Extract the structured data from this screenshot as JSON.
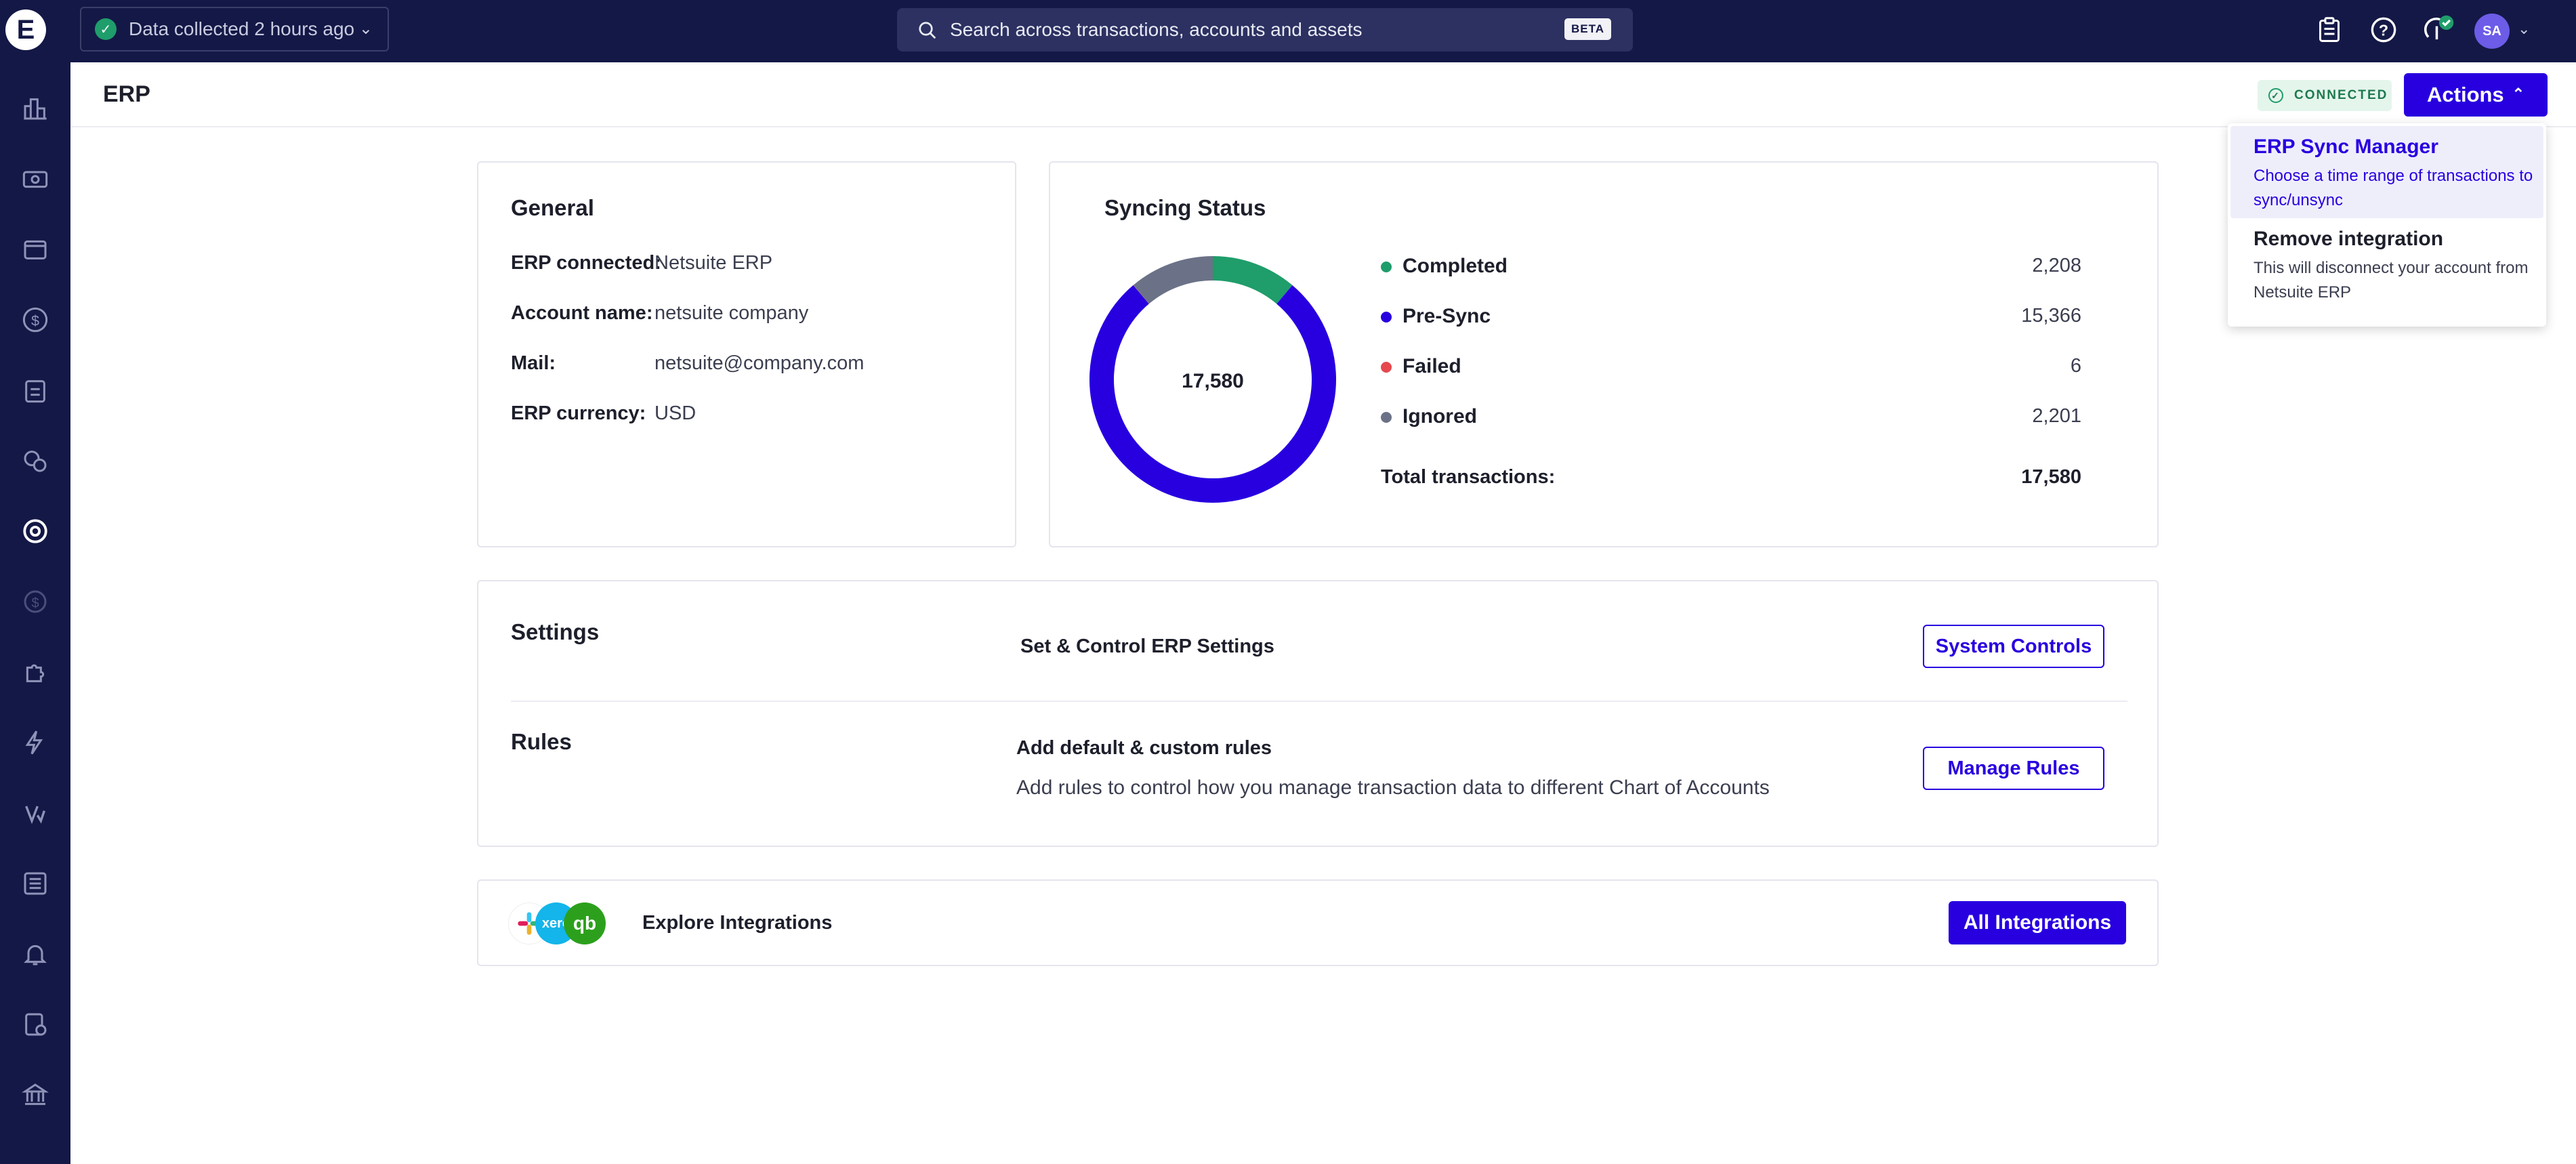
{
  "topbar": {
    "logo_letter": "E",
    "data_status": "Data collected 2 hours ago",
    "search_placeholder": "Search across transactions, accounts and assets",
    "search_badge": "BETA",
    "avatar_initials": "SA"
  },
  "sidebar": {
    "icons": [
      "dashboard-icon",
      "payments-icon",
      "wallet-icon",
      "dollar-icon",
      "clipboard-icon",
      "coins-info-icon",
      "erp-icon",
      "coin-disabled-icon",
      "puzzle-icon",
      "lightning-icon",
      "vendor-icon",
      "list-icon",
      "bell-icon",
      "document-check-icon",
      "bank-icon"
    ]
  },
  "header": {
    "title": "ERP",
    "status_badge": "CONNECTED",
    "actions_label": "Actions"
  },
  "actions_menu": {
    "items": [
      {
        "title": "ERP Sync Manager",
        "description": "Choose a time range of transactions to sync/unsync"
      },
      {
        "title": "Remove integration",
        "description": "This will disconnect your account from Netsuite ERP"
      }
    ]
  },
  "general": {
    "title": "General",
    "rows": [
      {
        "label": "ERP connected:",
        "value": "Netsuite ERP"
      },
      {
        "label": "Account name:",
        "value": "netsuite company"
      },
      {
        "label": "Mail:",
        "value": "netsuite@company.com"
      },
      {
        "label": "ERP currency:",
        "value": "USD"
      }
    ]
  },
  "syncing": {
    "title": "Syncing Status",
    "total_label": "Total transactions:",
    "total_value": "17,580",
    "center_value": "17,580"
  },
  "chart_data": {
    "type": "pie",
    "donut": true,
    "title": "Syncing Status",
    "categories": [
      "Completed",
      "Pre-Sync",
      "Failed",
      "Ignored"
    ],
    "values": [
      2208,
      15366,
      6,
      2201
    ],
    "display_values": [
      "2,208",
      "15,366",
      "6",
      "2,201"
    ],
    "colors": [
      "#1f9d6b",
      "#2800e0",
      "#e5484d",
      "#6b7287"
    ]
  },
  "settings": {
    "title": "Settings",
    "description": "Set & Control ERP Settings",
    "button": "System Controls"
  },
  "rules": {
    "title": "Rules",
    "heading": "Add default & custom rules",
    "description": "Add rules to control how you manage transaction data to different Chart of Accounts",
    "button": "Manage Rules"
  },
  "integrations": {
    "label": "Explore Integrations",
    "button": "All Integrations",
    "logo_texts": [
      "xero",
      "qb"
    ]
  }
}
